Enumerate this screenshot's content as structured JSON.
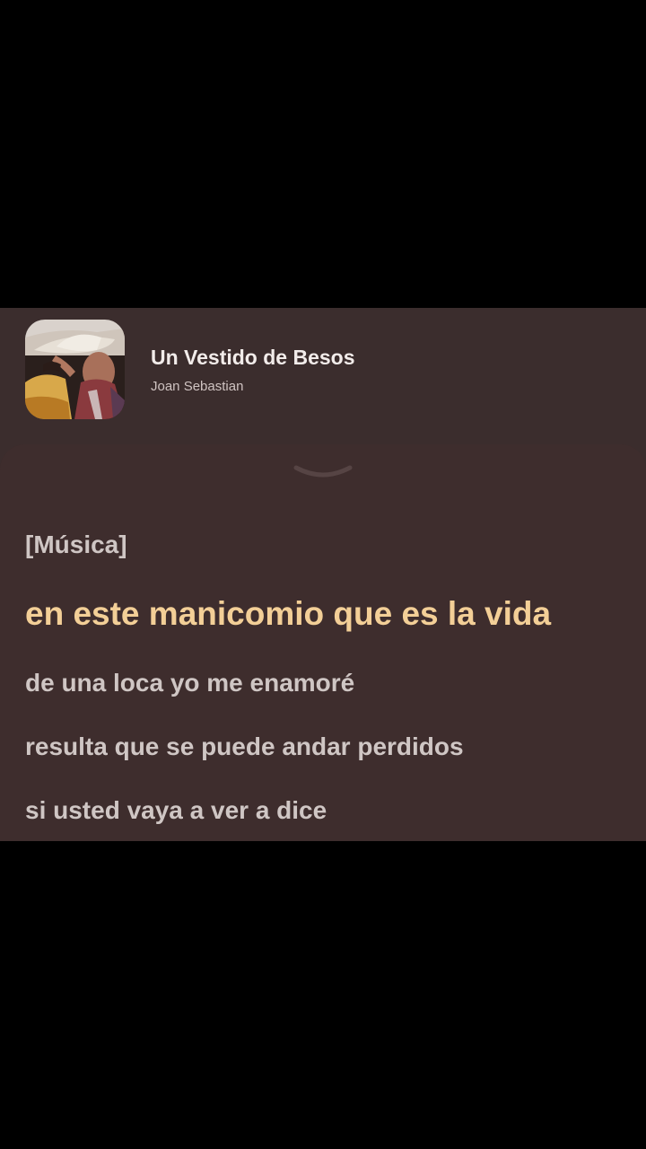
{
  "song": {
    "title": "Un Vestido de Besos",
    "artist": "Joan Sebastian"
  },
  "album_art": {
    "icon": "album-cover-image"
  },
  "handle": {
    "icon": "chevron-down-icon"
  },
  "lyrics": [
    "[Música]",
    "en este manicomio que es la vida",
    "de una loca yo me enamoré",
    "resulta que se puede andar perdidos",
    "si usted vaya a ver a dice"
  ],
  "active_line_index": 1,
  "colors": {
    "background": "#000000",
    "card": "#3b2d2d",
    "active_lyric": "#f3cf97",
    "inactive_lyric": "#cfc6c4"
  }
}
